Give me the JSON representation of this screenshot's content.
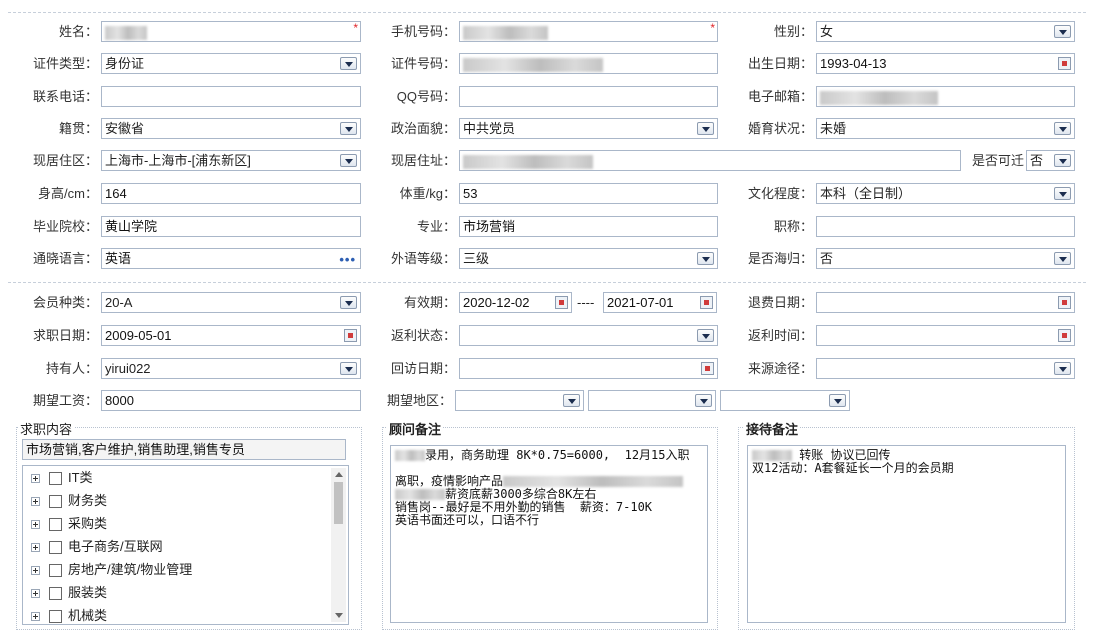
{
  "personal": {
    "name_label": "姓名：",
    "phone_label": "手机号码：",
    "gender_label": "性别：",
    "gender": "女",
    "idtype_label": "证件类型：",
    "idtype": "身份证",
    "idno_label": "证件号码：",
    "birth_label": "出生日期：",
    "birth": "1993-04-13",
    "tel_label": "联系电话：",
    "qq_label": "QQ号码：",
    "email_label": "电子邮箱：",
    "native_label": "籍贯：",
    "native": "安徽省",
    "political_label": "政治面貌：",
    "political": "中共党员",
    "marital_label": "婚育状况：",
    "marital": "未婚",
    "residence_label": "现居住区：",
    "residence": "上海市-上海市-[浦东新区]",
    "address_label": "现居住址：",
    "relocate_label": "是否可迁",
    "relocate": "否",
    "height_label": "身高/cm：",
    "height": "164",
    "weight_label": "体重/kg：",
    "weight": "53",
    "edu_label": "文化程度：",
    "edu": "本科（全日制）",
    "school_label": "毕业院校：",
    "school": "黄山学院",
    "major_label": "专业：",
    "major": "市场营销",
    "title_label": "职称：",
    "lang_label": "通晓语言：",
    "lang": "英语",
    "langlevel_label": "外语等级：",
    "langlevel": "三级",
    "overseas_label": "是否海归：",
    "overseas": "否"
  },
  "member": {
    "type_label": "会员种类：",
    "type": "20-A",
    "valid_label": "有效期：",
    "valid_from": "2020-12-02",
    "valid_sep": "----",
    "valid_to": "2021-07-01",
    "refund_label": "退费日期：",
    "jobdate_label": "求职日期：",
    "jobdate": "2009-05-01",
    "rebate_status_label": "返利状态：",
    "rebate_time_label": "返利时间：",
    "holder_label": "持有人：",
    "holder": "yirui022",
    "visit_label": "回访日期：",
    "source_label": "来源途径：",
    "salary_label": "期望工资：",
    "salary": "8000",
    "area_label": "期望地区："
  },
  "job": {
    "title": "求职内容",
    "selected": "市场营销,客户维护,销售助理,销售专员",
    "categories": [
      "IT类",
      "财务类",
      "采购类",
      "电子商务/互联网",
      "房地产/建筑/物业管理",
      "服装类",
      "机械类"
    ]
  },
  "consultant": {
    "title": "顾问备注",
    "line1": "录用，商务助理 8K*0.75=6000,  12月15入职",
    "line2": "",
    "line3": "离职，疫情影响产品",
    "line4": "薪资底薪3000多综合8K左右",
    "line5": "销售岗--最好是不用外勤的销售  薪资：7-10K",
    "line6": "英语书面还可以，口语不行"
  },
  "reception": {
    "title": "接待备注",
    "line1": "转账 协议已回传",
    "line2": "双12活动：A套餐延长一个月的会员期"
  }
}
